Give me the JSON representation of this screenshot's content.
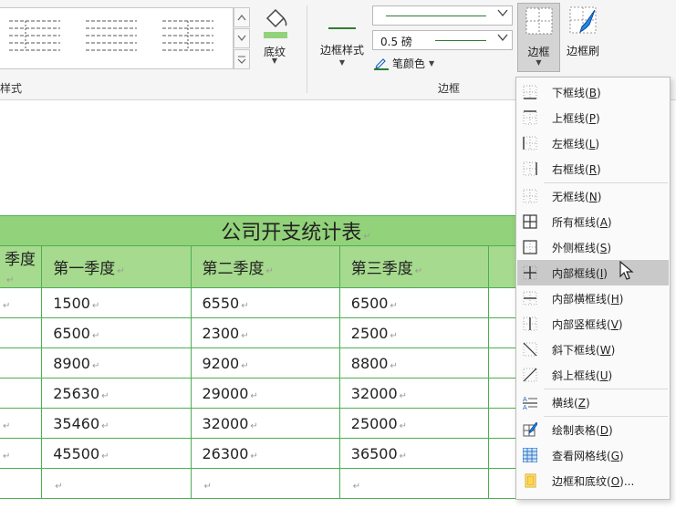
{
  "ribbon": {
    "group_partial_label": "样式",
    "shading_label": "底纹",
    "border_style_label": "边框样式",
    "line_weight": "0.5 磅",
    "pen_color_label": "笔颜色",
    "border_group_label": "边框",
    "border_button_label": "边框",
    "border_brush_label": "边框刷"
  },
  "table": {
    "title": "公司开支统计表",
    "headers": [
      "季度",
      "第一季度",
      "第二季度",
      "第三季度",
      ""
    ],
    "rows": [
      [
        "",
        "1500",
        "6550",
        "6500",
        ""
      ],
      [
        "",
        "6500",
        "2300",
        "2500",
        ""
      ],
      [
        "",
        "8900",
        "9200",
        "8800",
        ""
      ],
      [
        "",
        "25630",
        "29000",
        "32000",
        ""
      ],
      [
        "",
        "35460",
        "32000",
        "25000",
        ""
      ],
      [
        "",
        "45500",
        "26300",
        "36500",
        ""
      ],
      [
        "",
        "",
        "",
        "",
        ""
      ]
    ],
    "paragraph_mark": "↵"
  },
  "menu": {
    "items": [
      {
        "label": "下框线",
        "key": "B",
        "icon": "bottom-border-icon"
      },
      {
        "label": "上框线",
        "key": "P",
        "icon": "top-border-icon"
      },
      {
        "label": "左框线",
        "key": "L",
        "icon": "left-border-icon"
      },
      {
        "label": "右框线",
        "key": "R",
        "icon": "right-border-icon"
      },
      {
        "label": "无框线",
        "key": "N",
        "icon": "no-border-icon"
      },
      {
        "label": "所有框线",
        "key": "A",
        "icon": "all-borders-icon"
      },
      {
        "label": "外侧框线",
        "key": "S",
        "icon": "outside-borders-icon"
      },
      {
        "label": "内部框线",
        "key": "I",
        "icon": "inside-borders-icon"
      },
      {
        "label": "内部横框线",
        "key": "H",
        "icon": "inside-horizontal-border-icon"
      },
      {
        "label": "内部竖框线",
        "key": "V",
        "icon": "inside-vertical-border-icon"
      },
      {
        "label": "斜下框线",
        "key": "W",
        "icon": "diagonal-down-border-icon"
      },
      {
        "label": "斜上框线",
        "key": "U",
        "icon": "diagonal-up-border-icon"
      },
      {
        "label": "横线",
        "key": "Z",
        "icon": "horizontal-line-icon"
      },
      {
        "label": "绘制表格",
        "key": "D",
        "icon": "draw-table-icon"
      },
      {
        "label": "查看网格线",
        "key": "G",
        "icon": "view-gridlines-icon"
      },
      {
        "label": "边框和底纹",
        "key": "O",
        "suffix": "...",
        "icon": "borders-shading-icon"
      }
    ],
    "active_index": 7
  },
  "colors": {
    "title_fill": "#92d27a",
    "header_fill": "#a6da8e",
    "table_border": "#4caf50",
    "accent_green": "#2e7d32"
  }
}
